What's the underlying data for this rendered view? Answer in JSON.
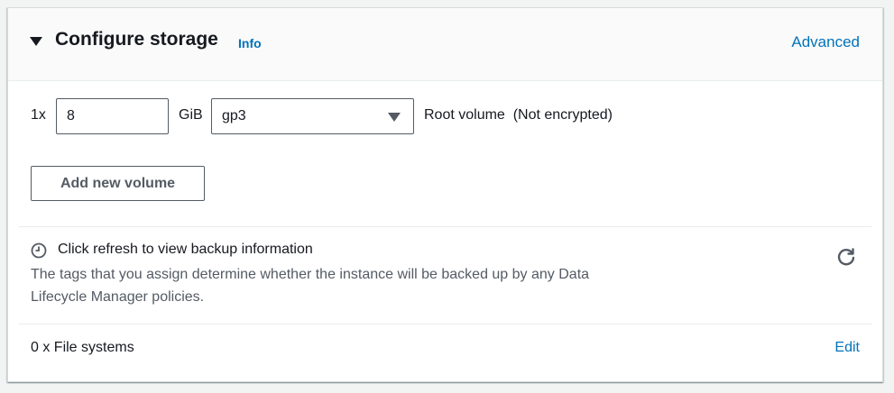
{
  "section": {
    "title": "Configure storage",
    "info_link": "Info",
    "advanced_link": "Advanced"
  },
  "volume": {
    "count_label": "1x",
    "size_value": "8",
    "unit": "GiB",
    "type_selected": "gp3",
    "description": "Root volume  (Not encrypted)"
  },
  "add_volume_button": "Add new volume",
  "backup": {
    "title": "Click refresh to view backup information",
    "description": "The tags that you assign determine whether the instance will be backed up by any Data Lifecycle Manager policies."
  },
  "file_systems": {
    "label": "0 x File systems",
    "edit_link": "Edit"
  },
  "icons": {
    "caret": "caret-down-icon",
    "select_arrow": "chevron-down-icon",
    "clock": "clock-icon",
    "refresh": "refresh-icon"
  },
  "colors": {
    "link": "#0073bb",
    "text": "#16191f",
    "secondary_text": "#545b64",
    "border": "#545b64",
    "header_bg": "#fafafa"
  }
}
